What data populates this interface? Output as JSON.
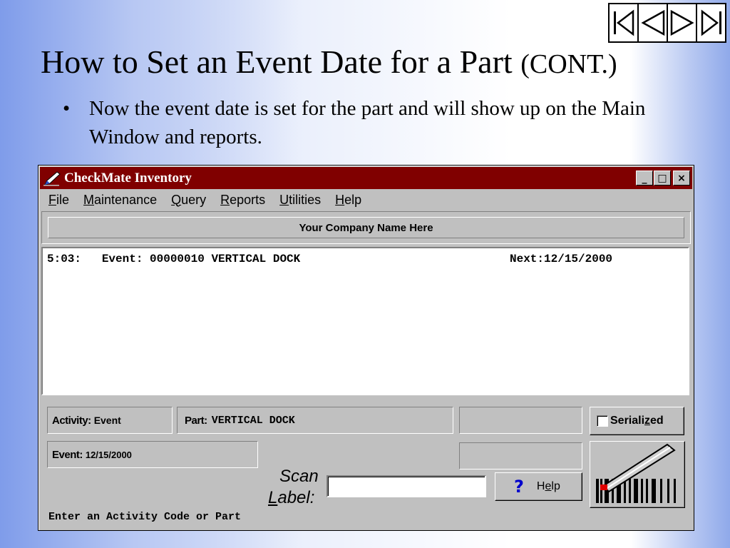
{
  "slide": {
    "title": "How to Set an Event Date for a Part",
    "title_suffix": "(CONT.)",
    "bullet_marker": "•",
    "bullet": "Now the event date is set for the part and will show up on the Main Window and reports."
  },
  "nav": {
    "buttons": [
      "first-slide-icon",
      "previous-slide-icon",
      "next-slide-icon",
      "last-slide-icon"
    ]
  },
  "window": {
    "title": "CheckMate Inventory",
    "minimize": "_",
    "maximize": "□",
    "close": "×",
    "menu": {
      "file_u": "F",
      "file_rest": "ile",
      "maintenance_u": "M",
      "maintenance_rest": "aintenance",
      "query_u": "Q",
      "query_rest": "uery",
      "reports_u": "R",
      "reports_rest": "eports",
      "utilities_u": "U",
      "utilities_rest": "tilities",
      "help_u": "H",
      "help_rest": "elp"
    },
    "company_name": "Your Company Name Here",
    "log": {
      "left": "5:03:   Event: 00000010 VERTICAL DOCK",
      "right": "Next:12/15/2000"
    },
    "activity_label": "Activity:",
    "activity_value": "Event",
    "part_label": "Part:",
    "part_value": "VERTICAL DOCK",
    "serialized_pre": "Seriali",
    "serialized_u": "z",
    "serialized_post": "ed",
    "event_label": "Event:",
    "event_value": "12/15/2000",
    "scan_word": "Scan",
    "label_u": "L",
    "label_rest": "abel:",
    "scan_value": "",
    "help_q": "?",
    "help_pre": "H",
    "help_u": "e",
    "help_post": "lp",
    "status_text": "Enter an Activity Code or Part"
  },
  "colors": {
    "titlebar": "#800000",
    "window_face": "#c0c0c0",
    "help_icon": "#0000cc"
  }
}
